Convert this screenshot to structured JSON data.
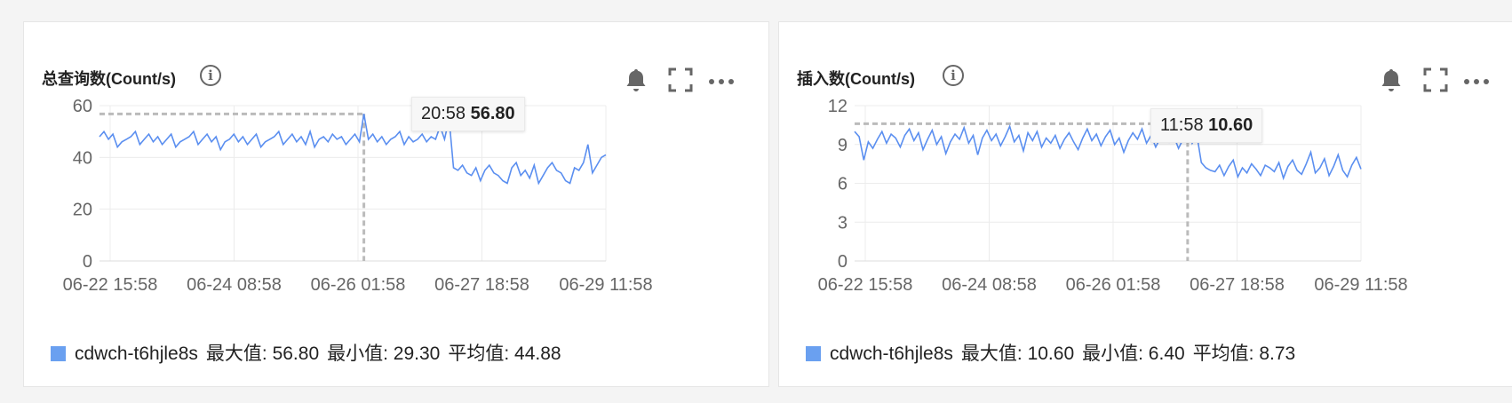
{
  "panels": [
    {
      "title": "总查询数(Count/s)",
      "info_icon": "info-icon",
      "tools": [
        "bell-icon",
        "fullscreen-icon",
        "more-icon"
      ],
      "tooltip": {
        "time": "20:58",
        "value": "56.80"
      },
      "legend": {
        "series": "cdwch-t6hjle8s",
        "max_label": "最大值: 56.80",
        "min_label": "最小值: 29.30",
        "avg_label": "平均值: 44.88"
      },
      "chart_data": {
        "type": "line",
        "x_tick_labels": [
          "06-22 15:58",
          "06-24 08:58",
          "06-26 01:58",
          "06-27 18:58",
          "06-29 11:58"
        ],
        "y_ticks": [
          0,
          20,
          40,
          60
        ],
        "ylim": [
          0,
          60
        ],
        "grid": true,
        "series": [
          {
            "name": "cdwch-t6hjle8s",
            "color": "#5b8ff0",
            "values": [
              48,
              50,
              47,
              49,
              44,
              46,
              47,
              48,
              50,
              45,
              47,
              49,
              46,
              48,
              45,
              47,
              49,
              44,
              46,
              47,
              48,
              50,
              45,
              47,
              49,
              46,
              48,
              43,
              46,
              47,
              49,
              46,
              48,
              45,
              47,
              49,
              44,
              46,
              47,
              48,
              50,
              45,
              47,
              49,
              46,
              48,
              45,
              50,
              44,
              47,
              48,
              46,
              49,
              47,
              48,
              45,
              47,
              49,
              46,
              56.8,
              47,
              49,
              46,
              48,
              45,
              47,
              48,
              50,
              45,
              48,
              46,
              47,
              49,
              46,
              48,
              47,
              52,
              47,
              55,
              36,
              35,
              37,
              34,
              33,
              36,
              31,
              35,
              37,
              34,
              33,
              31,
              30,
              36,
              38,
              33,
              35,
              32,
              37,
              30,
              33,
              36,
              38,
              35,
              34,
              31,
              30,
              36,
              35,
              38,
              45,
              34,
              37,
              40,
              41
            ]
          }
        ],
        "max": 56.8,
        "min": 29.3,
        "avg": 44.88,
        "highlight_index": 59
      }
    },
    {
      "title": "插入数(Count/s)",
      "info_icon": "info-icon",
      "tools": [
        "bell-icon",
        "fullscreen-icon",
        "more-icon"
      ],
      "tooltip": {
        "time": "11:58",
        "value": "10.60"
      },
      "legend": {
        "series": "cdwch-t6hjle8s",
        "max_label": "最大值: 10.60",
        "min_label": "最小值: 6.40",
        "avg_label": "平均值: 8.73"
      },
      "chart_data": {
        "type": "line",
        "x_tick_labels": [
          "06-22 15:58",
          "06-24 08:58",
          "06-26 01:58",
          "06-27 18:58",
          "06-29 11:58"
        ],
        "y_ticks": [
          0,
          3,
          6,
          9,
          12
        ],
        "ylim": [
          0,
          12
        ],
        "grid": true,
        "series": [
          {
            "name": "cdwch-t6hjle8s",
            "color": "#5b8ff0",
            "values": [
              10.0,
              9.6,
              7.8,
              9.2,
              8.7,
              9.4,
              10.0,
              9.1,
              9.8,
              9.5,
              8.8,
              9.7,
              10.2,
              9.3,
              9.9,
              8.6,
              9.4,
              10.1,
              9.0,
              9.6,
              8.3,
              9.2,
              9.8,
              9.4,
              10.3,
              9.1,
              9.7,
              8.2,
              9.5,
              10.1,
              9.3,
              9.8,
              8.9,
              9.6,
              10.4,
              9.2,
              9.7,
              8.5,
              9.9,
              9.3,
              10.0,
              8.8,
              9.5,
              9.1,
              9.7,
              8.7,
              9.4,
              9.9,
              9.2,
              8.6,
              9.5,
              10.2,
              9.3,
              9.8,
              8.9,
              9.6,
              10.1,
              9.0,
              9.5,
              8.4,
              9.3,
              9.9,
              9.4,
              10.2,
              9.1,
              9.7,
              8.8,
              9.5,
              10.3,
              9.2,
              9.6,
              8.7,
              9.4,
              10.6,
              9.1,
              9.8,
              7.6,
              7.2,
              7.0,
              6.9,
              7.4,
              6.6,
              7.3,
              7.8,
              6.5,
              7.2,
              6.8,
              7.5,
              7.1,
              6.6,
              7.4,
              7.2,
              6.9,
              7.6,
              6.4,
              7.3,
              7.8,
              7.0,
              6.7,
              7.5,
              8.4,
              6.8,
              7.2,
              7.9,
              6.6,
              7.3,
              8.2,
              7.0,
              6.5,
              7.4,
              8.0,
              7.1
            ]
          }
        ],
        "max": 10.6,
        "min": 6.4,
        "avg": 8.73,
        "highlight_index": 73
      }
    }
  ]
}
